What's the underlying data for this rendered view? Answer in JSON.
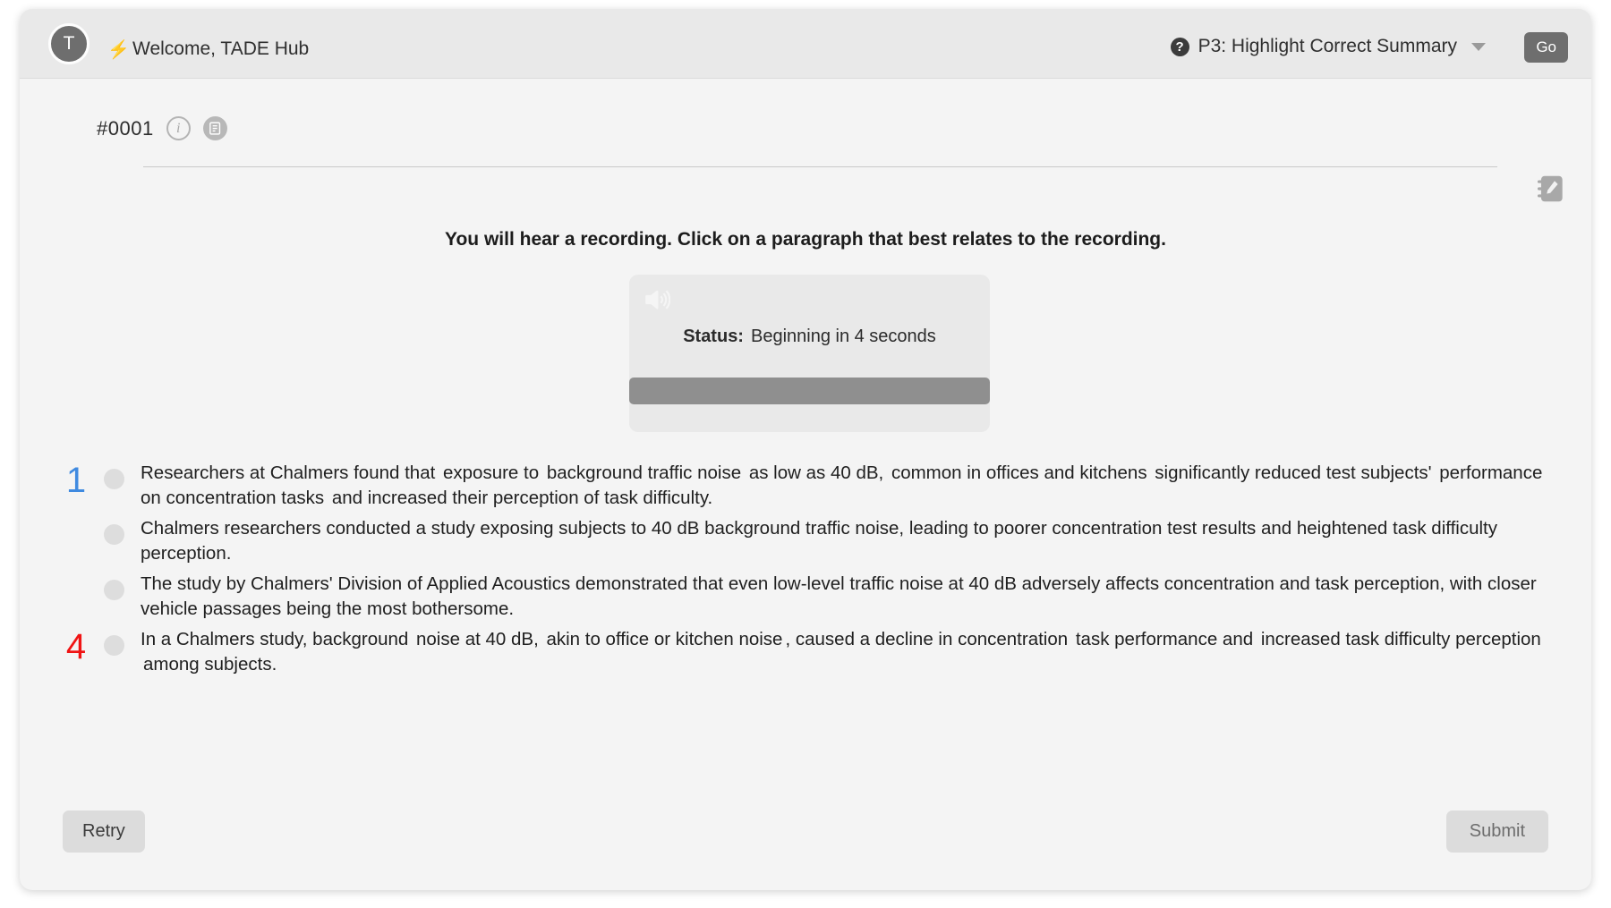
{
  "header": {
    "avatar_initial": "T",
    "bolt_icon": "bolt-icon",
    "welcome_text": "Welcome, TADE Hub",
    "help_icon_glyph": "?",
    "task_label": "P3: Highlight Correct Summary",
    "go_label": "Go"
  },
  "item": {
    "id": "#0001",
    "info_icon": "info-icon",
    "notes_icon": "notes-icon",
    "notebook_icon": "notebook-edit-icon"
  },
  "instruction": "You will hear a recording. Click on a paragraph that best relates to the recording.",
  "audio": {
    "speaker_icon": "speaker-icon",
    "status_label": "Status:",
    "status_value": "Beginning in 4 seconds",
    "progress_percent": 100
  },
  "paragraphs": [
    {
      "marker": "1",
      "marker_color": "#3f8ae0",
      "highlight_color": "#2b7fe8",
      "selected": false,
      "segments": [
        {
          "text": "Researchers at Chalmers found that ",
          "highlight": false
        },
        {
          "text": "exposure to ",
          "highlight": true
        },
        {
          "text": "background traffic noise",
          "highlight": false
        },
        {
          "text": " as low as 40 dB,",
          "highlight": true
        },
        {
          "text": " common in offices and kitchens",
          "highlight": false
        },
        {
          "text": " significantly reduced test subjects' ",
          "highlight": true
        },
        {
          "text": "performance on concentration tasks",
          "highlight": false
        },
        {
          "text": " and increased their perception of task difficulty.",
          "highlight": true
        }
      ]
    },
    {
      "marker": "",
      "marker_color": "",
      "highlight_color": "",
      "selected": false,
      "segments": [
        {
          "text": "Chalmers researchers conducted a study exposing subjects to 40 dB background traffic noise, leading to poorer concentration test results and heightened task difficulty perception.",
          "highlight": false
        }
      ]
    },
    {
      "marker": "",
      "marker_color": "",
      "highlight_color": "",
      "selected": false,
      "segments": [
        {
          "text": "The study by Chalmers' Division of Applied Acoustics demonstrated that even low-level traffic noise at 40 dB adversely affects concentration and task perception, with closer vehicle passages being the most bothersome.",
          "highlight": false
        }
      ]
    },
    {
      "marker": "4",
      "marker_color": "#f01414",
      "highlight_color": "#f21515",
      "selected": false,
      "segments": [
        {
          "text": "In a Chalmers study, background ",
          "highlight": false
        },
        {
          "text": "noise at 40 dB,",
          "highlight": true
        },
        {
          "text": " akin to office or kitchen noise",
          "highlight": false
        },
        {
          "text": ", caused a decline in concentration",
          "highlight": true
        },
        {
          "text": " task performance and",
          "highlight": false
        },
        {
          "text": " increased task difficulty perception among subjects.",
          "highlight": true
        }
      ]
    }
  ],
  "footer": {
    "retry_label": "Retry",
    "submit_label": "Submit"
  }
}
